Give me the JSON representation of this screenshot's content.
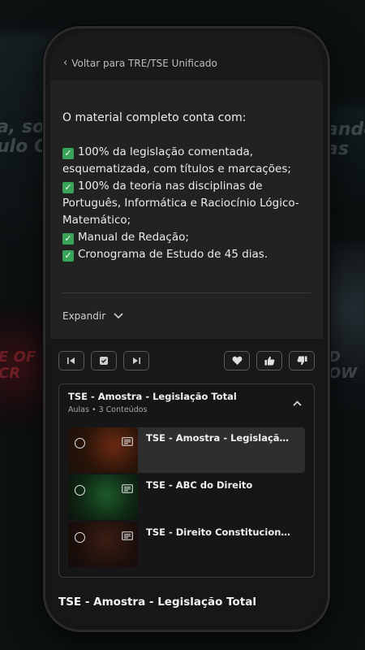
{
  "background": {
    "text_left": "a, sou\nulo Co",
    "text_right": "ando\nas",
    "text_left2": "E OF\nCR",
    "text_right2": "D\nOW"
  },
  "nav": {
    "back_label": "Voltar para TRE/TSE Unificado"
  },
  "description": {
    "heading": "O material completo conta com:",
    "items": [
      "100% da legislação comentada, esquematizada, com títulos e marcações;",
      "100% da teoria nas disciplinas de Português, Informática e Raciocínio Lógico-Matemático;",
      "Manual de Redação;",
      "Cronograma de Estudo de 45 dias."
    ],
    "expand_label": "Expandir"
  },
  "course": {
    "title": "TSE - Amostra - Legislação Total",
    "subtitle": "Aulas • 3 Conteúdos",
    "lessons": [
      {
        "title": "TSE - Amostra - Legislação Total"
      },
      {
        "title": "TSE - ABC do Direito"
      },
      {
        "title": "TSE - Direito Constitucional"
      }
    ]
  },
  "footer": {
    "current_title": "TSE - Amostra - Legislação Total"
  },
  "colors": {
    "accent_check": "#3aa35a",
    "panel": "#222222",
    "phone": "#161616"
  }
}
